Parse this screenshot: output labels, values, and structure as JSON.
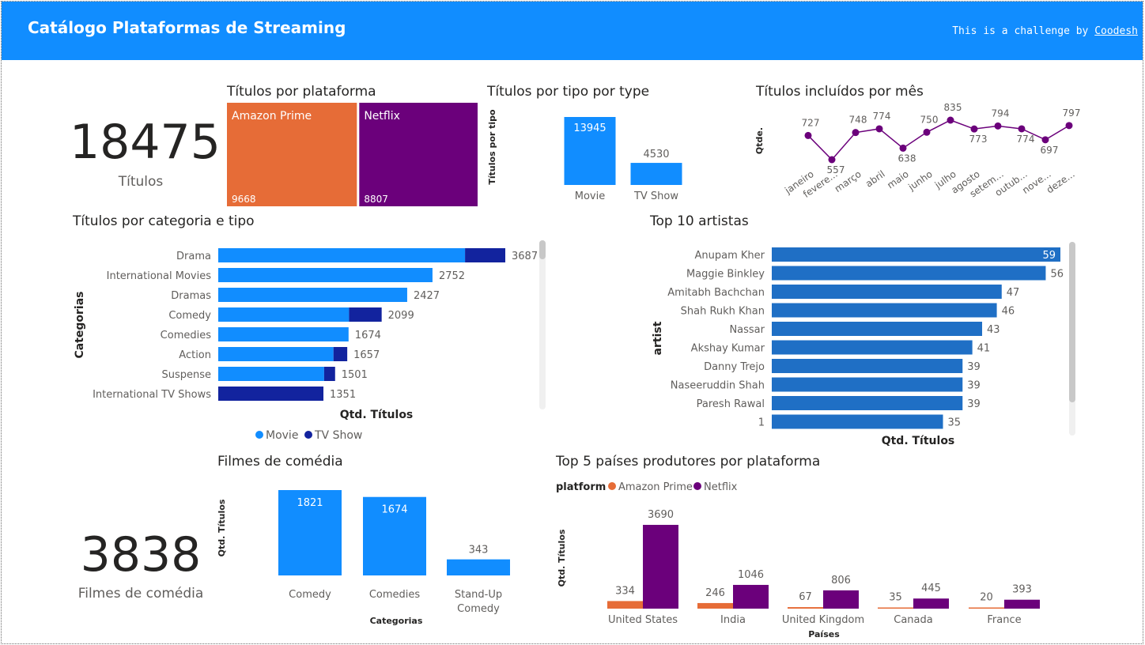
{
  "app": {
    "title": "Catálogo Plataformas de Streaming",
    "challenge_prefix": "This is a challenge by",
    "challenge_link": "Coodesh"
  },
  "colors": {
    "header": "#118dff",
    "movie": "#118dff",
    "tv_show": "#12239e",
    "amazon": "#e66c37",
    "netflix": "#6b007b",
    "artist_bar": "#1f6fc5"
  },
  "kpi_titles": {
    "value": "18475",
    "label": "Títulos"
  },
  "kpi_comedy": {
    "value": "3838",
    "label": "Filmes de comédia"
  },
  "visuals": {
    "platform_title": "Títulos por plataforma",
    "type_title": "Títulos por tipo por type",
    "month_title": "Títulos incluídos por mês",
    "category_title": "Títulos por categoria e tipo",
    "artists_title": "Top 10 artistas",
    "comedy_title": "Filmes de comédia",
    "countries_title": "Top 5 países produtores por plataforma"
  },
  "chart_data": [
    {
      "id": "platform",
      "type": "treemap",
      "categories": [
        "Amazon Prime",
        "Netflix"
      ],
      "values": [
        9668,
        8807
      ]
    },
    {
      "id": "type",
      "type": "bar",
      "categories": [
        "Movie",
        "TV Show"
      ],
      "values": [
        13945,
        4530
      ],
      "ylabel": "Títulos por tipo"
    },
    {
      "id": "month",
      "type": "line",
      "categories": [
        "janeiro",
        "fevere...",
        "março",
        "abril",
        "maio",
        "junho",
        "julho",
        "agosto",
        "setem...",
        "outub...",
        "nove...",
        "deze..."
      ],
      "values": [
        727,
        557,
        748,
        774,
        638,
        750,
        835,
        773,
        794,
        774,
        697,
        797
      ],
      "ylabel": "Qtde."
    },
    {
      "id": "category",
      "type": "bar",
      "orientation": "horizontal",
      "stacked": true,
      "categories": [
        "Drama",
        "International Movies",
        "Dramas",
        "Comedy",
        "Comedies",
        "Action",
        "Suspense",
        "International TV Shows"
      ],
      "totals": [
        3687,
        2752,
        2427,
        2099,
        1674,
        1657,
        1501,
        1351
      ],
      "series": [
        {
          "name": "Movie",
          "values": [
            3170,
            2752,
            2427,
            1680,
            1674,
            1480,
            1360,
            0
          ]
        },
        {
          "name": "TV Show",
          "values": [
            517,
            0,
            0,
            419,
            0,
            177,
            141,
            1351
          ]
        }
      ],
      "xlabel": "Qtd. Títulos",
      "ylabel": "Categorias",
      "legend": "bottom"
    },
    {
      "id": "artists",
      "type": "bar",
      "orientation": "horizontal",
      "categories": [
        "Anupam Kher",
        "Maggie Binkley",
        "Amitabh Bachchan",
        "Shah Rukh Khan",
        "Nassar",
        "Akshay Kumar",
        "Danny Trejo",
        "Naseeruddin Shah",
        "Paresh Rawal",
        "1"
      ],
      "values": [
        59,
        56,
        47,
        46,
        43,
        41,
        39,
        39,
        39,
        35
      ],
      "xlabel": "Qtd. Títulos",
      "ylabel": "artist"
    },
    {
      "id": "comedy",
      "type": "bar",
      "categories": [
        "Comedy",
        "Comedies",
        "Stand-Up Comedy"
      ],
      "values": [
        1821,
        1674,
        343
      ],
      "xlabel": "Categorias",
      "ylabel": "Qtd. Títulos"
    },
    {
      "id": "countries",
      "type": "bar",
      "categories": [
        "United States",
        "India",
        "United Kingdom",
        "Canada",
        "France"
      ],
      "series": [
        {
          "name": "Amazon Prime",
          "values": [
            334,
            246,
            67,
            35,
            20
          ]
        },
        {
          "name": "Netflix",
          "values": [
            3690,
            1046,
            806,
            445,
            393
          ]
        }
      ],
      "legend_title": "platform",
      "xlabel": "Países",
      "ylabel": "Qtd. Títulos",
      "legend": "top-left"
    }
  ]
}
